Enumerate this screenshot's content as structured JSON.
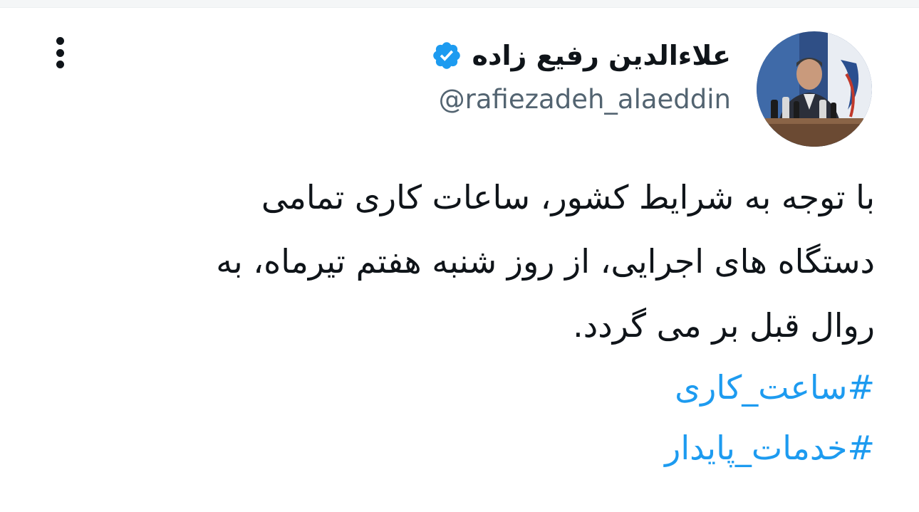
{
  "author": {
    "display_name": "علاءالدین رفیع زاده",
    "handle": "@rafiezadeh_alaeddin",
    "verified": true,
    "verified_badge_icon": "verified-badge-icon",
    "badge_color": "#1d9bf0"
  },
  "menu": {
    "icon": "more-vertical-icon"
  },
  "tweet": {
    "lines": [
      "با توجه به شرایط کشور، ساعات کاری تمامی",
      "دستگاه های اجرایی، از روز شنبه هفتم تیرماه، به",
      "روال قبل بر می گردد."
    ],
    "hashtags": [
      "#ساعت_کاری",
      "#خدمات_پایدار"
    ],
    "hashtag_color": "#1d9bf0"
  }
}
